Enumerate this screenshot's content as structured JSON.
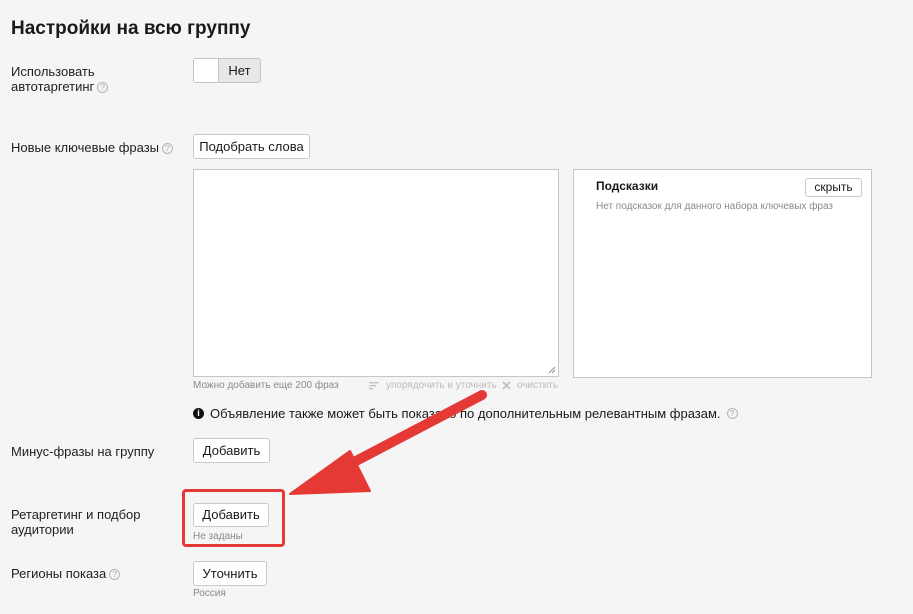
{
  "page_title": "Настройки на всю группу",
  "autotargeting": {
    "label_line1": "Использовать",
    "label_line2": "автотаргетинг",
    "toggle_value": "Нет"
  },
  "keywords": {
    "label": "Новые ключевые фразы",
    "pick_words_button": "Подобрать слова",
    "textarea_value": "",
    "counter_text": "Можно добавить еще 200 фраз",
    "sort_action": "упорядочить и уточнить",
    "clear_action": "очистить"
  },
  "hints_panel": {
    "title": "Подсказки",
    "hide_button": "скрыть",
    "empty_text": "Нет подсказок для данного набора ключевых фраз"
  },
  "notice": {
    "icon": "info-icon",
    "text": "Объявление также может быть показано по дополнительным релевантным фразам."
  },
  "minus_phrases": {
    "label": "Минус-фразы на группу",
    "add_button": "Добавить"
  },
  "retargeting": {
    "label_line1": "Ретаргетинг и подбор",
    "label_line2": "аудитории",
    "add_button": "Добавить",
    "status": "Не заданы"
  },
  "regions": {
    "label": "Регионы показа",
    "refine_button": "Уточнить",
    "value": "Россия"
  },
  "colors": {
    "annotation_red": "#e53935",
    "background": "#f5f5f5"
  }
}
